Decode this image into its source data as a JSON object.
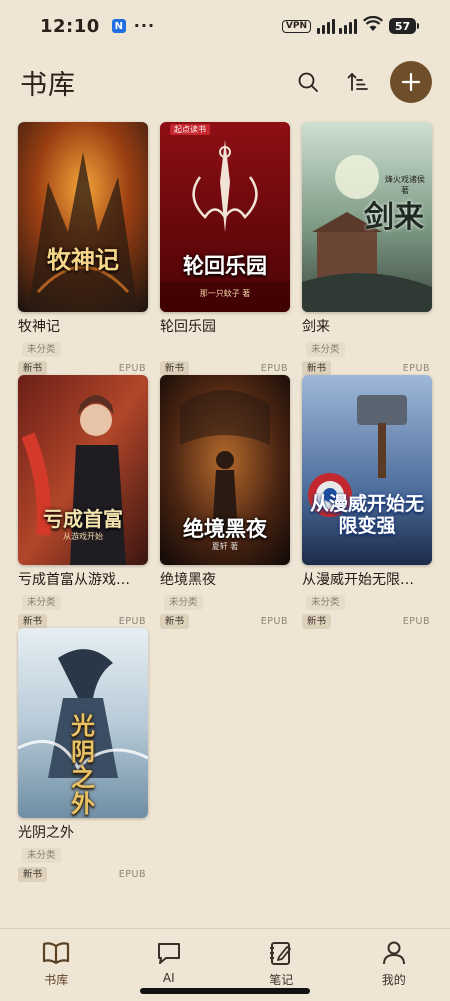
{
  "status_bar": {
    "time": "12:10",
    "notif_app": "N",
    "more": "···",
    "vpn": "VPN",
    "battery": "57"
  },
  "header": {
    "title": "书库"
  },
  "books": [
    {
      "title": "牧神记",
      "category": "未分类",
      "tag": "新书",
      "format": "EPUB",
      "cover_text": "牧神记",
      "cover_brand": "",
      "cover_author": ""
    },
    {
      "title": "轮回乐园",
      "category": "",
      "tag": "新书",
      "format": "EPUB",
      "cover_text": "轮回乐园",
      "cover_brand": "起点读书",
      "cover_author": "那一只蚊子 著"
    },
    {
      "title": "剑来",
      "category": "未分类",
      "tag": "新书",
      "format": "EPUB",
      "cover_text": "剑来",
      "cover_brand": "",
      "cover_author": "烽火戏诸侯 著"
    },
    {
      "title": "亏成首富从游戏…",
      "category": "未分类",
      "tag": "新书",
      "format": "EPUB",
      "cover_text": "亏成首富",
      "cover_brand": "",
      "cover_author": "从游戏开始"
    },
    {
      "title": "绝境黑夜",
      "category": "未分类",
      "tag": "新书",
      "format": "EPUB",
      "cover_text": "绝境黑夜",
      "cover_brand": "",
      "cover_author": "夏轩 著"
    },
    {
      "title": "从漫威开始无限…",
      "category": "未分类",
      "tag": "新书",
      "format": "EPUB",
      "cover_text": "从漫威开始无限变强",
      "cover_brand": "",
      "cover_author": ""
    },
    {
      "title": "光阴之外",
      "category": "未分类",
      "tag": "新书",
      "format": "EPUB",
      "cover_text": "光阴之外",
      "cover_brand": "",
      "cover_author": ""
    }
  ],
  "nav": [
    {
      "label": "书库",
      "icon": "book-open-icon",
      "active": true
    },
    {
      "label": "AI",
      "icon": "chat-bubble-icon",
      "active": false
    },
    {
      "label": "笔记",
      "icon": "notebook-pen-icon",
      "active": false
    },
    {
      "label": "我的",
      "icon": "person-icon",
      "active": false
    }
  ],
  "colors": {
    "background": "#efe5d4",
    "accent": "#6f4f2a"
  }
}
